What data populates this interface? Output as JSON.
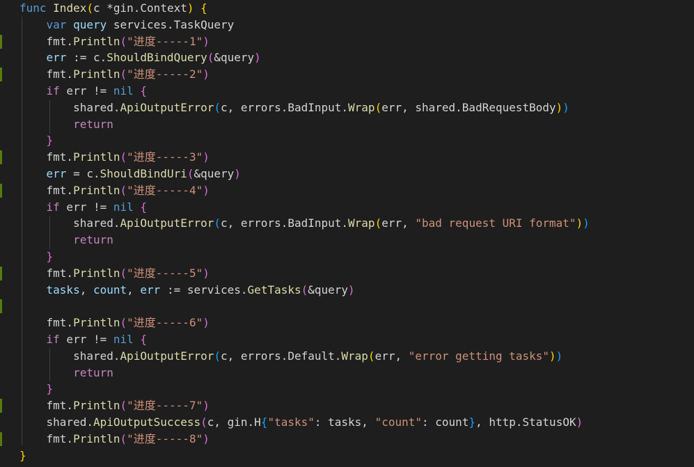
{
  "editor": {
    "lines": [
      {
        "marked": false,
        "tokens": [
          {
            "t": "func ",
            "c": "kw"
          },
          {
            "t": "Index",
            "c": "fn"
          },
          {
            "t": "(",
            "c": "brace1"
          },
          {
            "t": "c *gin.Context",
            "c": "plain"
          },
          {
            "t": ")",
            "c": "brace1"
          },
          {
            "t": " ",
            "c": "plain"
          },
          {
            "t": "{",
            "c": "brace1"
          }
        ]
      },
      {
        "marked": false,
        "tokens": [
          {
            "t": "    ",
            "c": "plain"
          },
          {
            "t": "var ",
            "c": "kw"
          },
          {
            "t": "query",
            "c": "var"
          },
          {
            "t": " services.TaskQuery",
            "c": "plain"
          }
        ]
      },
      {
        "marked": true,
        "tokens": [
          {
            "t": "    fmt.",
            "c": "plain"
          },
          {
            "t": "Println",
            "c": "fn"
          },
          {
            "t": "(",
            "c": "brace2"
          },
          {
            "t": "\"进度-----1\"",
            "c": "str"
          },
          {
            "t": ")",
            "c": "brace2"
          }
        ]
      },
      {
        "marked": false,
        "tokens": [
          {
            "t": "    ",
            "c": "plain"
          },
          {
            "t": "err",
            "c": "var"
          },
          {
            "t": " := c.",
            "c": "plain"
          },
          {
            "t": "ShouldBindQuery",
            "c": "fn"
          },
          {
            "t": "(",
            "c": "brace2"
          },
          {
            "t": "&query",
            "c": "plain"
          },
          {
            "t": ")",
            "c": "brace2"
          }
        ]
      },
      {
        "marked": true,
        "tokens": [
          {
            "t": "    fmt.",
            "c": "plain"
          },
          {
            "t": "Println",
            "c": "fn"
          },
          {
            "t": "(",
            "c": "brace2"
          },
          {
            "t": "\"进度-----2\"",
            "c": "str"
          },
          {
            "t": ")",
            "c": "brace2"
          }
        ]
      },
      {
        "marked": false,
        "tokens": [
          {
            "t": "    ",
            "c": "plain"
          },
          {
            "t": "if",
            "c": "ctrl"
          },
          {
            "t": " err != ",
            "c": "plain"
          },
          {
            "t": "nil",
            "c": "kw"
          },
          {
            "t": " ",
            "c": "plain"
          },
          {
            "t": "{",
            "c": "brace2"
          }
        ]
      },
      {
        "marked": false,
        "tokens": [
          {
            "t": "        shared.",
            "c": "plain"
          },
          {
            "t": "ApiOutputError",
            "c": "fn"
          },
          {
            "t": "(",
            "c": "brace3"
          },
          {
            "t": "c, errors.BadInput.",
            "c": "plain"
          },
          {
            "t": "Wrap",
            "c": "fn"
          },
          {
            "t": "(",
            "c": "brace1"
          },
          {
            "t": "err, shared.BadRequestBody",
            "c": "plain"
          },
          {
            "t": ")",
            "c": "brace1"
          },
          {
            "t": ")",
            "c": "brace3"
          }
        ]
      },
      {
        "marked": false,
        "tokens": [
          {
            "t": "        ",
            "c": "plain"
          },
          {
            "t": "return",
            "c": "ctrl"
          }
        ]
      },
      {
        "marked": false,
        "tokens": [
          {
            "t": "    ",
            "c": "plain"
          },
          {
            "t": "}",
            "c": "brace2"
          }
        ]
      },
      {
        "marked": true,
        "tokens": [
          {
            "t": "    fmt.",
            "c": "plain"
          },
          {
            "t": "Println",
            "c": "fn"
          },
          {
            "t": "(",
            "c": "brace2"
          },
          {
            "t": "\"进度-----3\"",
            "c": "str"
          },
          {
            "t": ")",
            "c": "brace2"
          }
        ]
      },
      {
        "marked": false,
        "tokens": [
          {
            "t": "    ",
            "c": "plain"
          },
          {
            "t": "err",
            "c": "var"
          },
          {
            "t": " = c.",
            "c": "plain"
          },
          {
            "t": "ShouldBindUri",
            "c": "fn"
          },
          {
            "t": "(",
            "c": "brace2"
          },
          {
            "t": "&query",
            "c": "plain"
          },
          {
            "t": ")",
            "c": "brace2"
          }
        ]
      },
      {
        "marked": true,
        "tokens": [
          {
            "t": "    fmt.",
            "c": "plain"
          },
          {
            "t": "Println",
            "c": "fn"
          },
          {
            "t": "(",
            "c": "brace2"
          },
          {
            "t": "\"进度-----4\"",
            "c": "str"
          },
          {
            "t": ")",
            "c": "brace2"
          }
        ]
      },
      {
        "marked": false,
        "tokens": [
          {
            "t": "    ",
            "c": "plain"
          },
          {
            "t": "if",
            "c": "ctrl"
          },
          {
            "t": " err != ",
            "c": "plain"
          },
          {
            "t": "nil",
            "c": "kw"
          },
          {
            "t": " ",
            "c": "plain"
          },
          {
            "t": "{",
            "c": "brace2"
          }
        ]
      },
      {
        "marked": false,
        "tokens": [
          {
            "t": "        shared.",
            "c": "plain"
          },
          {
            "t": "ApiOutputError",
            "c": "fn"
          },
          {
            "t": "(",
            "c": "brace3"
          },
          {
            "t": "c, errors.BadInput.",
            "c": "plain"
          },
          {
            "t": "Wrap",
            "c": "fn"
          },
          {
            "t": "(",
            "c": "brace1"
          },
          {
            "t": "err, ",
            "c": "plain"
          },
          {
            "t": "\"bad request URI format\"",
            "c": "str"
          },
          {
            "t": ")",
            "c": "brace1"
          },
          {
            "t": ")",
            "c": "brace3"
          }
        ]
      },
      {
        "marked": false,
        "tokens": [
          {
            "t": "        ",
            "c": "plain"
          },
          {
            "t": "return",
            "c": "ctrl"
          }
        ]
      },
      {
        "marked": false,
        "tokens": [
          {
            "t": "    ",
            "c": "plain"
          },
          {
            "t": "}",
            "c": "brace2"
          }
        ]
      },
      {
        "marked": true,
        "tokens": [
          {
            "t": "    fmt.",
            "c": "plain"
          },
          {
            "t": "Println",
            "c": "fn"
          },
          {
            "t": "(",
            "c": "brace2"
          },
          {
            "t": "\"进度-----5\"",
            "c": "str"
          },
          {
            "t": ")",
            "c": "brace2"
          }
        ]
      },
      {
        "marked": false,
        "tokens": [
          {
            "t": "    ",
            "c": "plain"
          },
          {
            "t": "tasks",
            "c": "var"
          },
          {
            "t": ", ",
            "c": "plain"
          },
          {
            "t": "count",
            "c": "var"
          },
          {
            "t": ", ",
            "c": "plain"
          },
          {
            "t": "err",
            "c": "var"
          },
          {
            "t": " := services.",
            "c": "plain"
          },
          {
            "t": "GetTasks",
            "c": "fn"
          },
          {
            "t": "(",
            "c": "brace2"
          },
          {
            "t": "&query",
            "c": "plain"
          },
          {
            "t": ")",
            "c": "brace2"
          }
        ]
      },
      {
        "marked": true,
        "tokens": []
      },
      {
        "marked": false,
        "tokens": [
          {
            "t": "    fmt.",
            "c": "plain"
          },
          {
            "t": "Println",
            "c": "fn"
          },
          {
            "t": "(",
            "c": "brace2"
          },
          {
            "t": "\"进度-----6\"",
            "c": "str"
          },
          {
            "t": ")",
            "c": "brace2"
          }
        ]
      },
      {
        "marked": false,
        "tokens": [
          {
            "t": "    ",
            "c": "plain"
          },
          {
            "t": "if",
            "c": "ctrl"
          },
          {
            "t": " err != ",
            "c": "plain"
          },
          {
            "t": "nil",
            "c": "kw"
          },
          {
            "t": " ",
            "c": "plain"
          },
          {
            "t": "{",
            "c": "brace2"
          }
        ]
      },
      {
        "marked": false,
        "tokens": [
          {
            "t": "        shared.",
            "c": "plain"
          },
          {
            "t": "ApiOutputError",
            "c": "fn"
          },
          {
            "t": "(",
            "c": "brace3"
          },
          {
            "t": "c, errors.Default.",
            "c": "plain"
          },
          {
            "t": "Wrap",
            "c": "fn"
          },
          {
            "t": "(",
            "c": "brace1"
          },
          {
            "t": "err, ",
            "c": "plain"
          },
          {
            "t": "\"error getting tasks\"",
            "c": "str"
          },
          {
            "t": ")",
            "c": "brace1"
          },
          {
            "t": ")",
            "c": "brace3"
          }
        ]
      },
      {
        "marked": false,
        "tokens": [
          {
            "t": "        ",
            "c": "plain"
          },
          {
            "t": "return",
            "c": "ctrl"
          }
        ]
      },
      {
        "marked": false,
        "tokens": [
          {
            "t": "    ",
            "c": "plain"
          },
          {
            "t": "}",
            "c": "brace2"
          }
        ]
      },
      {
        "marked": true,
        "tokens": [
          {
            "t": "    fmt.",
            "c": "plain"
          },
          {
            "t": "Println",
            "c": "fn"
          },
          {
            "t": "(",
            "c": "brace2"
          },
          {
            "t": "\"进度-----7\"",
            "c": "str"
          },
          {
            "t": ")",
            "c": "brace2"
          }
        ]
      },
      {
        "marked": false,
        "tokens": [
          {
            "t": "    shared.",
            "c": "plain"
          },
          {
            "t": "ApiOutputSuccess",
            "c": "fn"
          },
          {
            "t": "(",
            "c": "brace2"
          },
          {
            "t": "c, gin.H",
            "c": "plain"
          },
          {
            "t": "{",
            "c": "brace3"
          },
          {
            "t": "\"tasks\"",
            "c": "str"
          },
          {
            "t": ": tasks, ",
            "c": "plain"
          },
          {
            "t": "\"count\"",
            "c": "str"
          },
          {
            "t": ": count",
            "c": "plain"
          },
          {
            "t": "}",
            "c": "brace3"
          },
          {
            "t": ", http.StatusOK",
            "c": "plain"
          },
          {
            "t": ")",
            "c": "brace2"
          }
        ]
      },
      {
        "marked": true,
        "tokens": [
          {
            "t": "    fmt.",
            "c": "plain"
          },
          {
            "t": "Println",
            "c": "fn"
          },
          {
            "t": "(",
            "c": "brace2"
          },
          {
            "t": "\"进度-----8\"",
            "c": "str"
          },
          {
            "t": ")",
            "c": "brace2"
          }
        ]
      },
      {
        "marked": false,
        "tokens": [
          {
            "t": "}",
            "c": "brace1"
          }
        ]
      }
    ]
  }
}
